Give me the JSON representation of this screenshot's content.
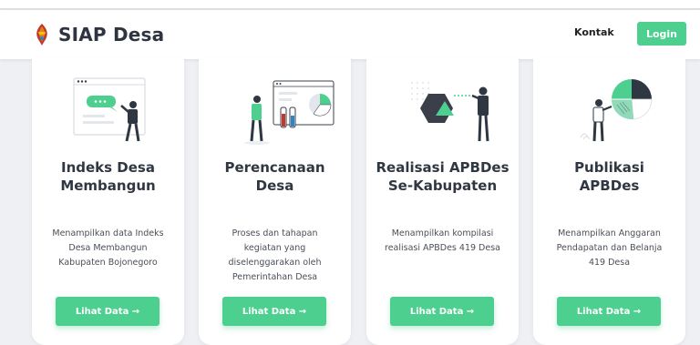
{
  "app": {
    "name": "SIAP Desa"
  },
  "nav": {
    "contact_label": "Kontak",
    "login_label": "Login"
  },
  "colors": {
    "accent": "#4ccf8f",
    "dark": "#2f3742"
  },
  "cards": [
    {
      "title_line1": "Indeks Desa",
      "title_line2": "Membangun",
      "desc_lines": [
        "Menampilkan data Indeks",
        "Desa Membangun",
        "Kabupaten Bojonegoro"
      ],
      "button_label": "Lihat Data →",
      "icon": "chat-message-illustration"
    },
    {
      "title_line1": "Perencanaan",
      "title_line2": "Desa",
      "desc_lines": [
        "Proses dan tahapan",
        "kegiatan yang",
        "diselenggarakan oleh",
        "Pemerintahan Desa"
      ],
      "button_label": "Lihat Data →",
      "icon": "planning-dashboard-illustration"
    },
    {
      "title_line1": "Realisasi APBDes",
      "title_line2": "Se-Kabupaten",
      "desc_lines": [
        "Menampilkan kompilasi",
        "realisasi APBDes 419 Desa"
      ],
      "button_label": "Lihat Data →",
      "icon": "hexagon-analysis-illustration"
    },
    {
      "title_line1": "Publikasi",
      "title_line2": "APBDes",
      "desc_lines": [
        "Menampilkan Anggaran",
        "Pendapatan dan Belanja",
        "419 Desa"
      ],
      "button_label": "Lihat Data →",
      "icon": "pie-chart-illustration"
    }
  ]
}
